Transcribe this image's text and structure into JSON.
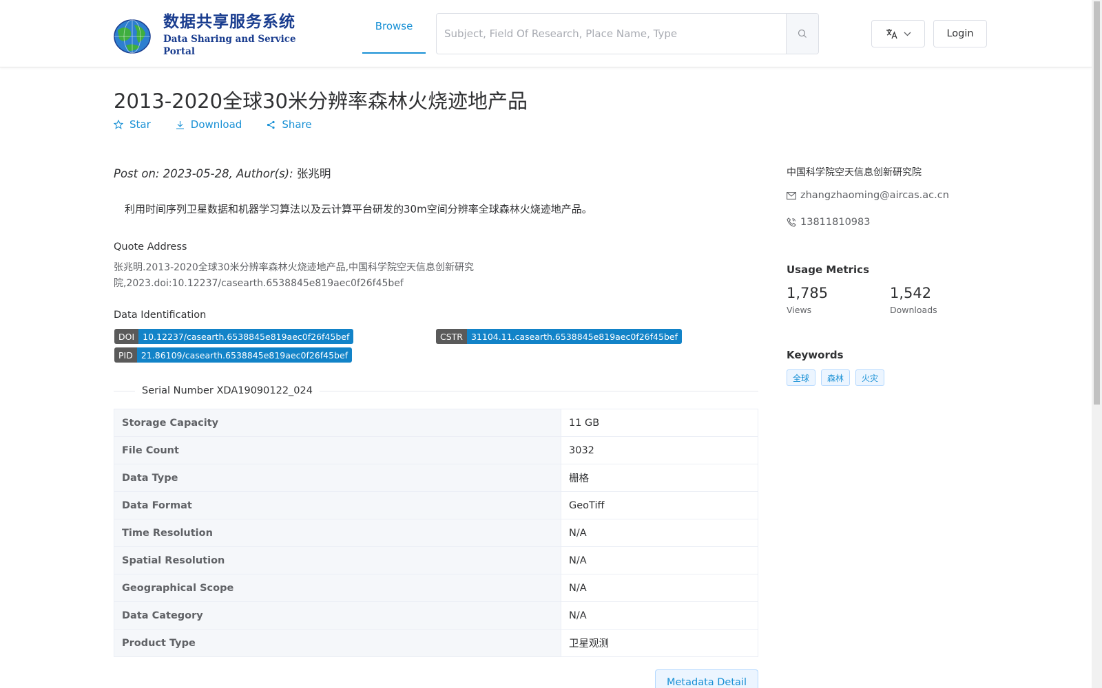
{
  "header": {
    "logo_cn": "数据共享服务系统",
    "logo_en": "Data Sharing and Service Portal",
    "nav_browse": "Browse",
    "search_placeholder": "Subject, Field Of Research, Place Name, Type",
    "login": "Login"
  },
  "dataset": {
    "title": "2013-2020全球30米分辨率森林火烧迹地产品",
    "actions": {
      "star": "Star",
      "download": "Download",
      "share": "Share"
    },
    "post_on_label": "Post on: 2023-05-28, Author(s): ",
    "author": "张兆明",
    "description": "利用时间序列卫星数据和机器学习算法以及云计算平台研发的30m空间分辨率全球森林火烧迹地产品。",
    "quote_label": "Quote Address",
    "quote_text": "张兆明.2013-2020全球30米分辨率森林火烧迹地产品,中国科学院空天信息创新研究院,2023.doi:10.12237/casearth.6538845e819aec0f26f45bef",
    "ident_label": "Data Identification",
    "ids": {
      "doi_key": "DOI",
      "doi_val": "10.12237/casearth.6538845e819aec0f26f45bef",
      "cstr_key": "CSTR",
      "cstr_val": "31104.11.casearth.6538845e819aec0f26f45bef",
      "pid_key": "PID",
      "pid_val": "21.86109/casearth.6538845e819aec0f26f45bef"
    },
    "serial": "Serial Number XDA19090122_024",
    "specs": [
      {
        "k": "Storage Capacity",
        "v": "11 GB"
      },
      {
        "k": "File Count",
        "v": "3032"
      },
      {
        "k": "Data Type",
        "v": "栅格"
      },
      {
        "k": "Data Format",
        "v": "GeoTiff"
      },
      {
        "k": "Time Resolution",
        "v": "N/A"
      },
      {
        "k": "Spatial Resolution",
        "v": "N/A"
      },
      {
        "k": "Geographical Scope",
        "v": "N/A"
      },
      {
        "k": "Data Category",
        "v": "N/A"
      },
      {
        "k": "Product Type",
        "v": "卫星观测"
      }
    ],
    "metadata_button": "Metadata Detail"
  },
  "sidebar": {
    "org": "中国科学院空天信息创新研究院",
    "email": "zhangzhaoming@aircas.ac.cn",
    "phone": "13811810983",
    "usage_heading": "Usage Metrics",
    "views_num": "1,785",
    "views_label": "Views",
    "downloads_num": "1,542",
    "downloads_label": "Downloads",
    "keywords_heading": "Keywords",
    "keywords": [
      "全球",
      "森林",
      "火灾"
    ]
  },
  "colors": {
    "accent": "#1890d5",
    "tag_key": "#5a5a5a",
    "tag_val": "#1283c8"
  }
}
